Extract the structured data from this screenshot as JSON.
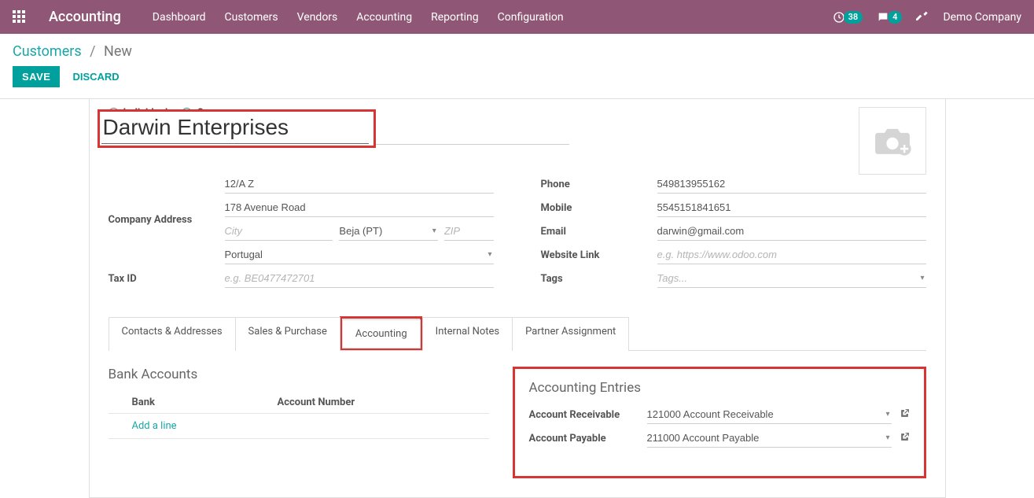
{
  "topbar": {
    "brand": "Accounting",
    "nav": {
      "dashboard": "Dashboard",
      "customers": "Customers",
      "vendors": "Vendors",
      "accounting": "Accounting",
      "reporting": "Reporting",
      "configuration": "Configuration"
    },
    "clock_badge": "38",
    "chat_badge": "4",
    "company": "Demo Company"
  },
  "breadcrumb": {
    "root": "Customers",
    "current": "New"
  },
  "actions": {
    "save": "SAVE",
    "discard": "DISCARD"
  },
  "typeRadios": {
    "individual": "Individual",
    "company": "Company"
  },
  "name": "Darwin Enterprises",
  "left": {
    "companyAddressLabel": "Company Address",
    "street1": "12/A Z",
    "street2": "178 Avenue Road",
    "cityPlaceholder": "City",
    "state": "Beja (PT)",
    "zipPlaceholder": "ZIP",
    "country": "Portugal",
    "taxIdLabel": "Tax ID",
    "taxIdPlaceholder": "e.g. BE0477472701"
  },
  "right": {
    "phoneLabel": "Phone",
    "phone": "549813955162",
    "mobileLabel": "Mobile",
    "mobile": "5545151841651",
    "emailLabel": "Email",
    "email": "darwin@gmail.com",
    "websiteLabel": "Website Link",
    "websitePlaceholder": "e.g. https://www.odoo.com",
    "tagsLabel": "Tags",
    "tagsPlaceholder": "Tags..."
  },
  "tabs": {
    "contacts": "Contacts & Addresses",
    "sales": "Sales & Purchase",
    "accounting": "Accounting",
    "notes": "Internal Notes",
    "partner": "Partner Assignment"
  },
  "bank": {
    "title": "Bank Accounts",
    "colBank": "Bank",
    "colAcct": "Account Number",
    "addLine": "Add a line"
  },
  "entries": {
    "title": "Accounting Entries",
    "recvLabel": "Account Receivable",
    "recvVal": "121000 Account Receivable",
    "payLabel": "Account Payable",
    "payVal": "211000 Account Payable"
  }
}
